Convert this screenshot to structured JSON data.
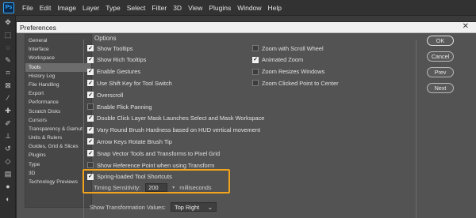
{
  "app": {
    "logo": "Ps",
    "menu": [
      "File",
      "Edit",
      "Image",
      "Layer",
      "Type",
      "Select",
      "Filter",
      "3D",
      "View",
      "Plugins",
      "Window",
      "Help"
    ]
  },
  "dialog": {
    "title": "Preferences",
    "close_glyph": "✕",
    "section_title": "Options",
    "categories": [
      {
        "label": "General",
        "selected": false
      },
      {
        "label": "Interface",
        "selected": false
      },
      {
        "label": "Workspace",
        "selected": false
      },
      {
        "label": "Tools",
        "selected": true
      },
      {
        "label": "History Log",
        "selected": false
      },
      {
        "label": "File Handling",
        "selected": false
      },
      {
        "label": "Export",
        "selected": false
      },
      {
        "label": "Performance",
        "selected": false
      },
      {
        "label": "Scratch Disks",
        "selected": false
      },
      {
        "label": "Cursors",
        "selected": false
      },
      {
        "label": "Transparency & Gamut",
        "selected": false
      },
      {
        "label": "Units & Rulers",
        "selected": false
      },
      {
        "label": "Guides, Grid & Slices",
        "selected": false
      },
      {
        "label": "Plugins",
        "selected": false
      },
      {
        "label": "Type",
        "selected": false
      },
      {
        "label": "3D",
        "selected": false
      },
      {
        "label": "Technology Previews",
        "selected": false
      }
    ],
    "left_options": [
      {
        "label": "Show Tooltips",
        "checked": true
      },
      {
        "label": "Show Rich Tooltips",
        "checked": true
      },
      {
        "label": "Enable Gestures",
        "checked": true
      },
      {
        "label": "Use Shift Key for Tool Switch",
        "checked": true
      },
      {
        "label": "Overscroll",
        "checked": true
      },
      {
        "label": "Enable Flick Panning",
        "checked": false
      },
      {
        "label": "Double Click Layer Mask Launches Select and Mask Workspace",
        "checked": true
      },
      {
        "label": "Vary Round Brush Hardness based on HUD vertical movement",
        "checked": true
      },
      {
        "label": "Arrow Keys Rotate Brush Tip",
        "checked": true
      },
      {
        "label": "Snap Vector Tools and Transforms to Pixel Grid",
        "checked": true
      },
      {
        "label": "Show Reference Point when using Transform",
        "checked": false
      },
      {
        "label": "Spring-loaded Tool Shortcuts",
        "checked": true
      }
    ],
    "right_options": [
      {
        "label": "Zoom with Scroll Wheel",
        "checked": false
      },
      {
        "label": "Animated Zoom",
        "checked": true
      },
      {
        "label": "Zoom Resizes Windows",
        "checked": false
      },
      {
        "label": "Zoom Clicked Point to Center",
        "checked": false
      }
    ],
    "timing": {
      "label": "Timing Sensitivity:",
      "value": "200",
      "unit": "milliseconds"
    },
    "transform_values": {
      "label": "Show Transformation Values:",
      "value": "Top Right"
    },
    "buttons": {
      "ok": "OK",
      "cancel": "Cancel",
      "prev": "Prev",
      "next": "Next"
    }
  },
  "colors": {
    "highlight": "#f1a31b",
    "dialog_bg": "#535353"
  }
}
